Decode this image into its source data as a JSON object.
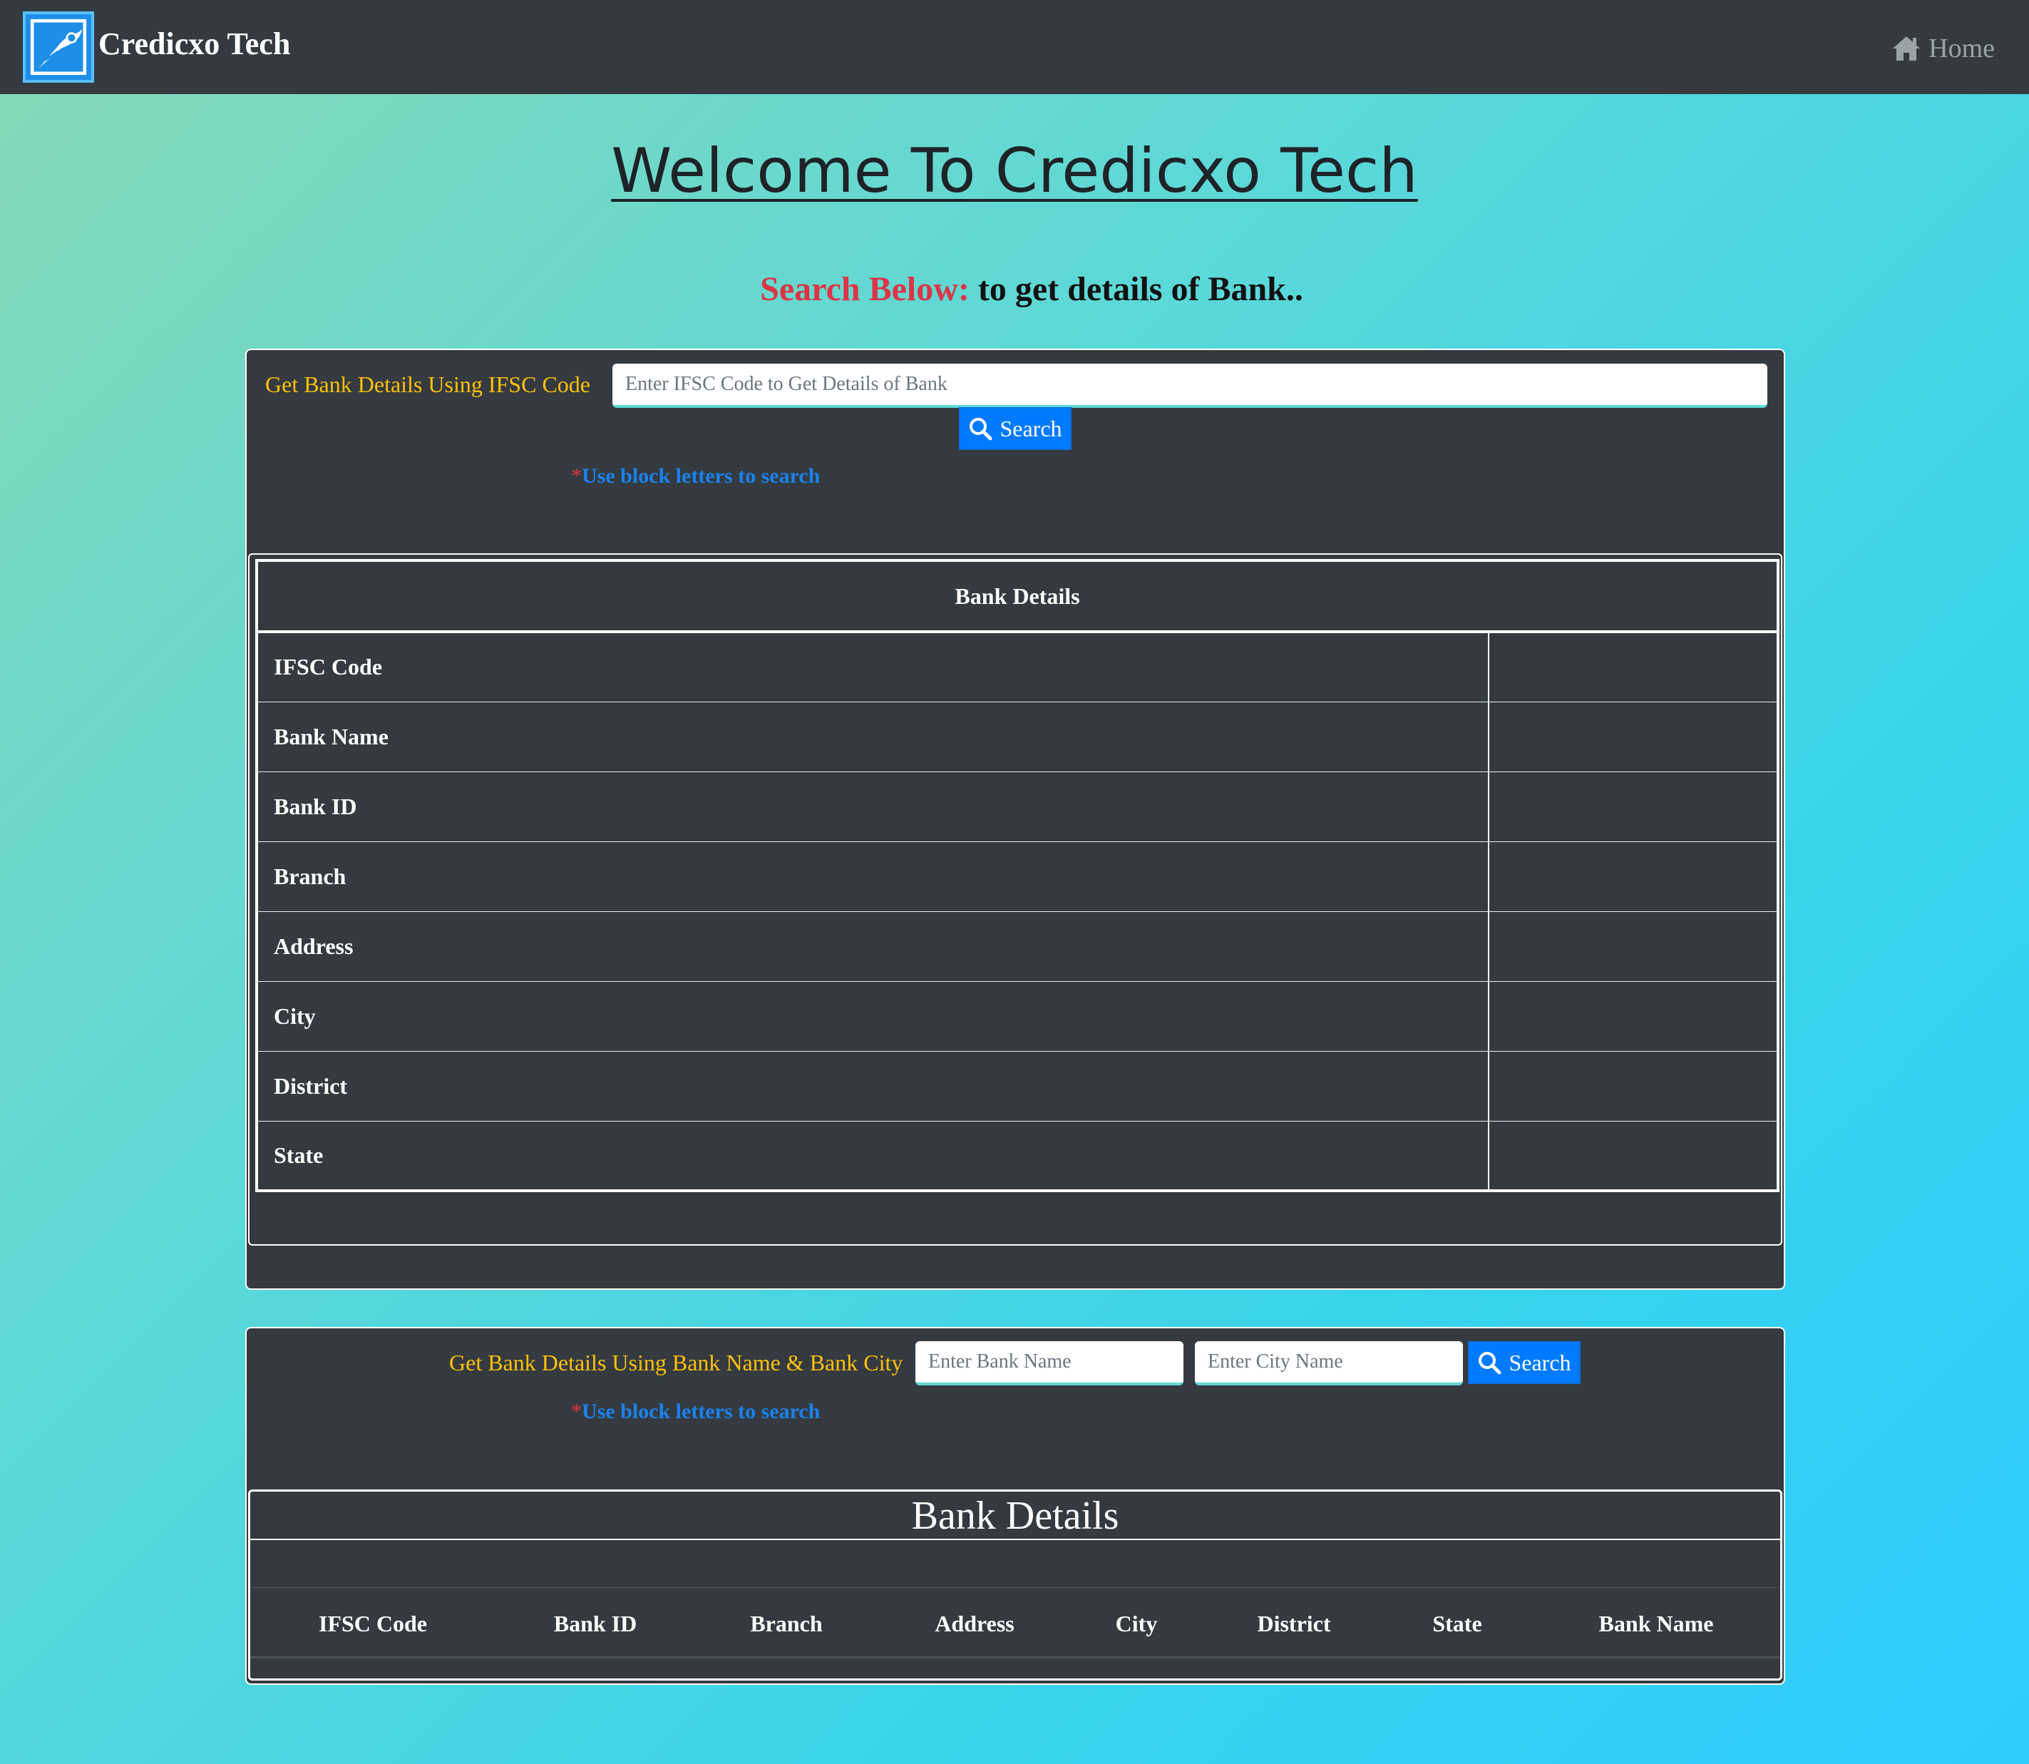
{
  "navbar": {
    "brand": "Credicxo Tech",
    "home_label": "Home",
    "logo_icon": "bird-logo-icon",
    "home_icon": "home-icon"
  },
  "hero": {
    "welcome": "Welcome To Credicxo Tech",
    "subtitle_highlight": "Search Below:",
    "subtitle_rest": " to get details of Bank.."
  },
  "ifsc_search": {
    "label": "Get Bank Details Using IFSC Code",
    "input_placeholder": "Enter IFSC Code to Get Details of Bank",
    "button_label": "Search",
    "note_star": "*",
    "note_text": "Use block letters to search"
  },
  "details_table": {
    "header": "Bank Details",
    "rows": [
      {
        "label": "IFSC Code",
        "value": ""
      },
      {
        "label": "Bank Name",
        "value": ""
      },
      {
        "label": "Bank ID",
        "value": ""
      },
      {
        "label": "Branch",
        "value": ""
      },
      {
        "label": "Address",
        "value": ""
      },
      {
        "label": "City",
        "value": ""
      },
      {
        "label": "District",
        "value": ""
      },
      {
        "label": "State",
        "value": ""
      }
    ]
  },
  "name_city_search": {
    "label": "Get Bank Details Using Bank Name & Bank City",
    "bank_placeholder": "Enter Bank Name",
    "city_placeholder": "Enter City Name",
    "button_label": "Search",
    "note_star": "*",
    "note_text": "Use block letters to search"
  },
  "results_table": {
    "title": "Bank Details",
    "columns": [
      "IFSC Code",
      "Bank ID",
      "Branch",
      "Address",
      "City",
      "District",
      "State",
      "Bank Name"
    ]
  },
  "colors": {
    "navbar": "#343a40",
    "accent_blue": "#007bff",
    "label_gold": "#ffc107",
    "highlight_red": "#dc3545"
  }
}
